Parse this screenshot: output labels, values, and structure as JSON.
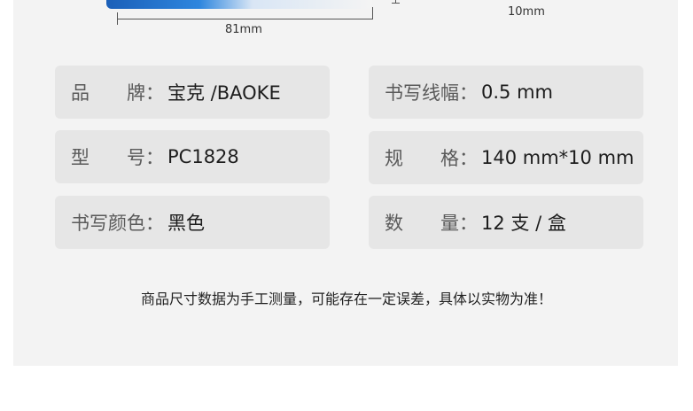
{
  "dimensions": {
    "width_label": "81mm",
    "height_label": "10mm"
  },
  "specs": {
    "brand": {
      "label": "品　　牌：",
      "value": "宝克 /BAOKE"
    },
    "line_width": {
      "label": "书写线幅：",
      "value": "0.5 mm"
    },
    "model": {
      "label": "型　　号：",
      "value": "PC1828"
    },
    "size": {
      "label": "规　　格：",
      "value": "140 mm*10 mm"
    },
    "ink_color": {
      "label": "书写颜色：",
      "value": "黑色"
    },
    "quantity": {
      "label": "数　　量：",
      "value": "12 支 / 盒"
    }
  },
  "disclaimer": "商品尺寸数据为手工测量，可能存在一定误差，具体以实物为准！",
  "colors": {
    "panel": "#f3f3f3",
    "box": "#e6e6e6",
    "product_blue": "#1b5fb8"
  }
}
